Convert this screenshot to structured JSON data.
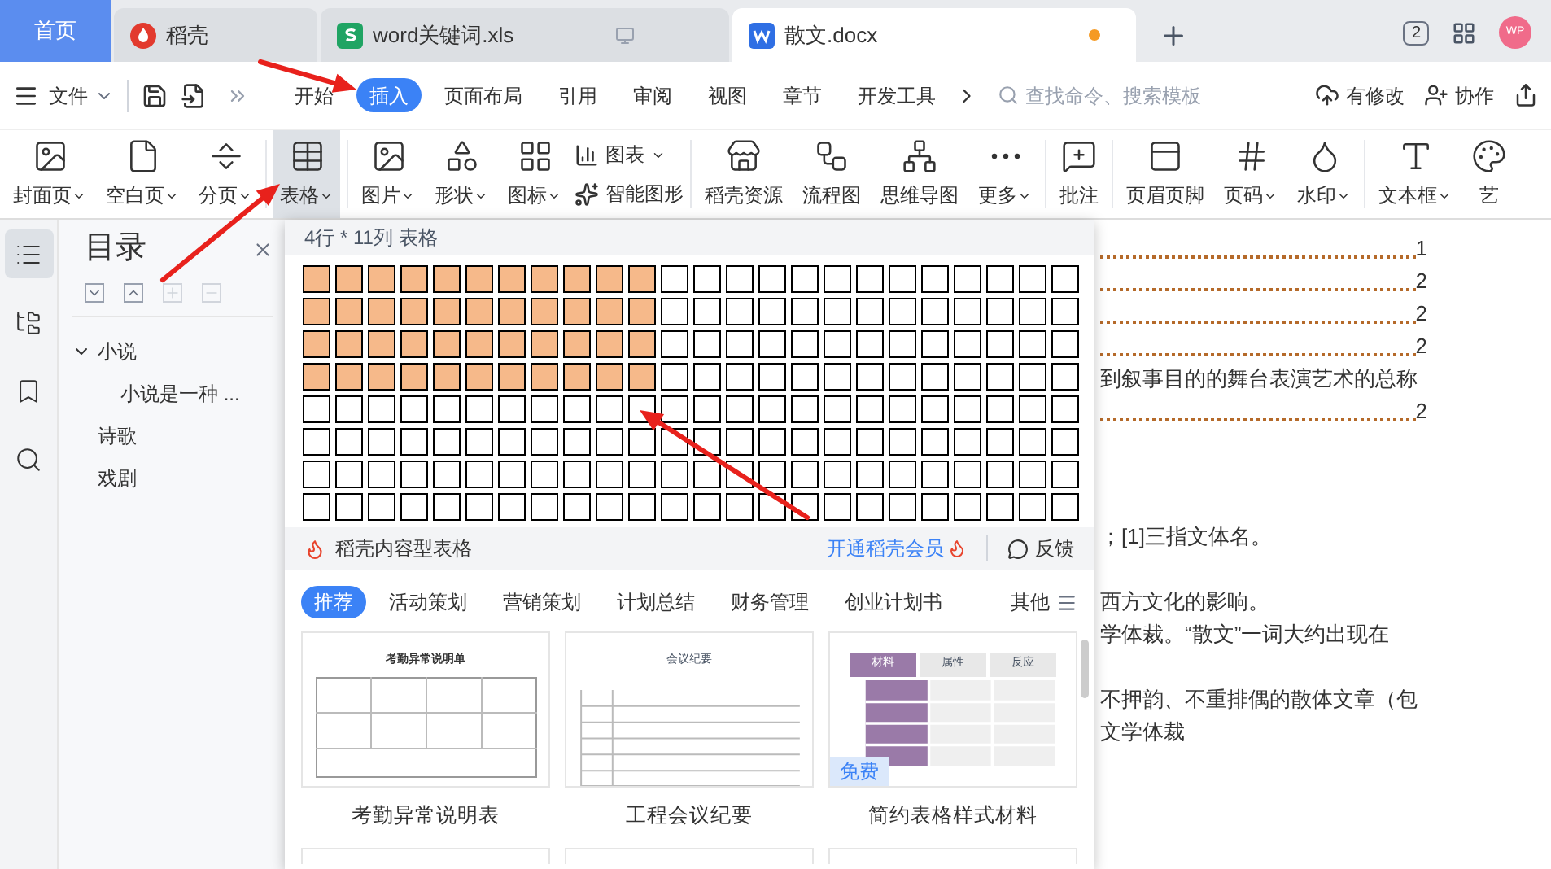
{
  "tabs": [
    {
      "label": "首页",
      "kind": "home",
      "selected": false
    },
    {
      "label": "稻壳",
      "kind": "docer",
      "selected": false
    },
    {
      "label": "word关键词.xls",
      "kind": "sheet",
      "selected": false
    },
    {
      "label": "散文.docx",
      "kind": "doc",
      "selected": true,
      "unsaved": true
    }
  ],
  "window_count": "2",
  "avatar": "WP",
  "menu": {
    "file": "文件",
    "tabs": [
      {
        "label": "开始",
        "selected": false
      },
      {
        "label": "插入",
        "selected": true
      },
      {
        "label": "页面布局",
        "selected": false
      },
      {
        "label": "引用",
        "selected": false
      },
      {
        "label": "审阅",
        "selected": false
      },
      {
        "label": "视图",
        "selected": false
      },
      {
        "label": "章节",
        "selected": false
      },
      {
        "label": "开发工具",
        "selected": false
      }
    ],
    "search": {
      "placeholder": "查找命令、搜索模板"
    },
    "actions": [
      {
        "label": "有修改",
        "kind": "cloud"
      },
      {
        "label": "协作",
        "kind": "user"
      },
      {
        "kind": "share"
      }
    ]
  },
  "ribbon": [
    {
      "items": [
        {
          "label": "封面页",
          "kind": "cover",
          "dropdown": true,
          "selected": false
        },
        {
          "label": "空白页",
          "kind": "blank",
          "dropdown": true,
          "selected": false
        },
        {
          "label": "分页",
          "kind": "break",
          "dropdown": true,
          "selected": false
        }
      ]
    },
    {
      "items": [
        {
          "label": "表格",
          "kind": "table",
          "dropdown": true,
          "selected": true
        }
      ]
    },
    {
      "items": [
        {
          "label": "图片",
          "kind": "picture",
          "dropdown": true,
          "selected": false
        },
        {
          "label": "形状",
          "kind": "shape",
          "dropdown": true,
          "selected": false
        },
        {
          "label": "图标",
          "kind": "icons",
          "dropdown": true,
          "selected": false
        },
        {
          "kind": "stack",
          "items": [
            {
              "label": "图表",
              "kind": "chart",
              "dropdown": true
            },
            {
              "label": "智能图形",
              "kind": "smart",
              "dropdown": false
            }
          ]
        }
      ]
    },
    {
      "items": [
        {
          "label": "稻壳资源",
          "kind": "store",
          "dropdown": false,
          "selected": false
        },
        {
          "label": "流程图",
          "kind": "flow",
          "dropdown": false,
          "selected": false
        },
        {
          "label": "思维导图",
          "kind": "mind",
          "dropdown": false,
          "selected": false
        },
        {
          "label": "更多",
          "kind": "more",
          "dropdown": true,
          "selected": false
        }
      ]
    },
    {
      "items": [
        {
          "label": "批注",
          "kind": "comment",
          "dropdown": false,
          "selected": false
        }
      ]
    },
    {
      "items": [
        {
          "label": "页眉页脚",
          "kind": "header",
          "dropdown": false,
          "selected": false
        },
        {
          "label": "页码",
          "kind": "pagenum",
          "dropdown": true,
          "selected": false
        },
        {
          "label": "水印",
          "kind": "watermark",
          "dropdown": true,
          "selected": false
        }
      ]
    },
    {
      "items": [
        {
          "label": "文本框",
          "kind": "textbox",
          "dropdown": true,
          "selected": false
        },
        {
          "label": "艺",
          "kind": "art",
          "dropdown": false,
          "selected": false
        }
      ]
    }
  ],
  "side_strip": [
    {
      "kind": "toc",
      "selected": true
    },
    {
      "kind": "tree",
      "selected": false
    },
    {
      "kind": "bookmark",
      "selected": false
    },
    {
      "kind": "search",
      "selected": false
    }
  ],
  "nav": {
    "title": "目录",
    "tree": [
      {
        "label": "小说",
        "expanded": true,
        "children": [
          {
            "label": "小说是一种 ..."
          }
        ]
      },
      {
        "label": "诗歌"
      },
      {
        "label": "戏剧"
      }
    ]
  },
  "table_menu": {
    "header": "4行 * 11列 表格",
    "grid_rows": [
      {
        "cells": [
          true,
          true,
          true,
          true,
          true,
          true,
          true,
          true,
          true,
          true,
          true,
          false,
          false,
          false,
          false,
          false,
          false,
          false,
          false,
          false,
          false,
          false,
          false,
          false
        ]
      },
      {
        "cells": [
          true,
          true,
          true,
          true,
          true,
          true,
          true,
          true,
          true,
          true,
          true,
          false,
          false,
          false,
          false,
          false,
          false,
          false,
          false,
          false,
          false,
          false,
          false,
          false
        ]
      },
      {
        "cells": [
          true,
          true,
          true,
          true,
          true,
          true,
          true,
          true,
          true,
          true,
          true,
          false,
          false,
          false,
          false,
          false,
          false,
          false,
          false,
          false,
          false,
          false,
          false,
          false
        ]
      },
      {
        "cells": [
          true,
          true,
          true,
          true,
          true,
          true,
          true,
          true,
          true,
          true,
          true,
          false,
          false,
          false,
          false,
          false,
          false,
          false,
          false,
          false,
          false,
          false,
          false,
          false
        ]
      },
      {
        "cells": [
          false,
          false,
          false,
          false,
          false,
          false,
          false,
          false,
          false,
          false,
          false,
          false,
          false,
          false,
          false,
          false,
          false,
          false,
          false,
          false,
          false,
          false,
          false,
          false
        ]
      },
      {
        "cells": [
          false,
          false,
          false,
          false,
          false,
          false,
          false,
          false,
          false,
          false,
          false,
          false,
          false,
          false,
          false,
          false,
          false,
          false,
          false,
          false,
          false,
          false,
          false,
          false
        ]
      },
      {
        "cells": [
          false,
          false,
          false,
          false,
          false,
          false,
          false,
          false,
          false,
          false,
          false,
          false,
          false,
          false,
          false,
          false,
          false,
          false,
          false,
          false,
          false,
          false,
          false,
          false
        ]
      },
      {
        "cells": [
          false,
          false,
          false,
          false,
          false,
          false,
          false,
          false,
          false,
          false,
          false,
          false,
          false,
          false,
          false,
          false,
          false,
          false,
          false,
          false,
          false,
          false,
          false,
          false
        ]
      }
    ],
    "brand": "稻壳内容型表格",
    "member_link": "开通稻壳会员",
    "feedback": "反馈",
    "categories": [
      {
        "label": "推荐",
        "selected": true
      },
      {
        "label": "活动策划",
        "selected": false
      },
      {
        "label": "营销策划",
        "selected": false
      },
      {
        "label": "计划总结",
        "selected": false
      },
      {
        "label": "财务管理",
        "selected": false
      },
      {
        "label": "创业计划书",
        "selected": false
      }
    ],
    "more": "其他",
    "templates": [
      {
        "name": "考勤异常说明表",
        "kind": "form",
        "title": "考勤异常说明单"
      },
      {
        "name": "工程会议纪要",
        "kind": "minutes",
        "title": "会议纪要"
      },
      {
        "name": "简约表格样式材料",
        "kind": "styled",
        "columns": [
          "材料",
          "属性",
          "反应"
        ],
        "badge": "免费"
      }
    ]
  },
  "document": {
    "toc": [
      {
        "kind": "leader",
        "page": "1"
      },
      {
        "kind": "leader",
        "page": "2"
      },
      {
        "kind": "leader",
        "page": "2"
      },
      {
        "kind": "leader",
        "page": "2"
      },
      {
        "kind": "text",
        "text": "到叙事目的的舞台表演艺术的总称"
      },
      {
        "kind": "leader",
        "page": "2"
      }
    ],
    "paragraphs": [
      {
        "lines": [
          "；[1]三指文体名。"
        ]
      },
      {
        "lines": [
          "西方文化的影响。",
          "学体裁。“散文”一词大约出现在"
        ]
      },
      {
        "lines": [
          "不押韵、不重排偶的散体文章（包",
          "文学体裁"
        ]
      }
    ]
  }
}
